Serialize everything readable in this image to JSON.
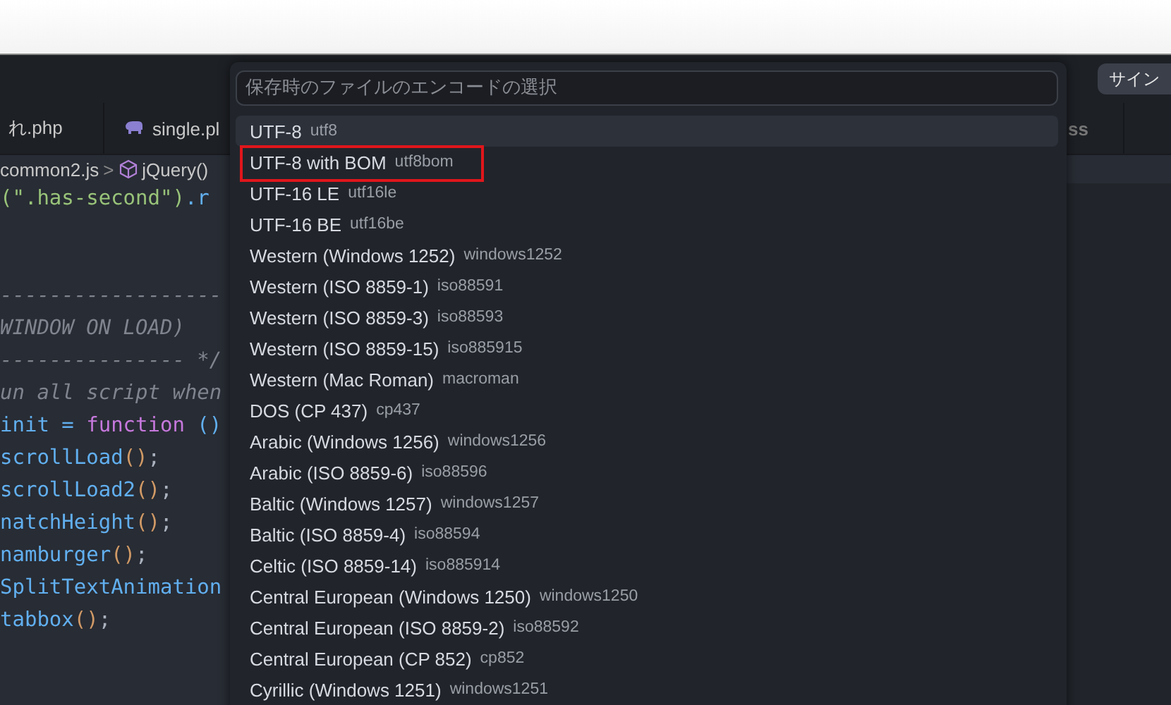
{
  "title_bar": {
    "button": "サイン"
  },
  "tabs": [
    {
      "label": "れ.php",
      "kind": "plain",
      "selected": false
    },
    {
      "label": "single.pl",
      "kind": "php",
      "selected": false
    },
    {
      "label": "ss",
      "kind": "plain",
      "selected": false
    }
  ],
  "breadcrumb": {
    "file": "common2.js",
    "separator": ">",
    "symbol": "jQuery()"
  },
  "code_lines": [
    [
      {
        "t": "(\".has-second\")",
        "kind": "str"
      },
      {
        "t": ".r",
        "kind": "fn"
      }
    ],
    [
      {
        "t": "------------------",
        "kind": "com"
      }
    ],
    [
      {
        "t": "WINDOW ON LOAD)",
        "kind": "com"
      }
    ],
    [
      {
        "t": "--------------- */",
        "kind": "com"
      }
    ],
    [
      {
        "t": "un all script when",
        "kind": "com"
      }
    ],
    [
      {
        "t": "init = ",
        "kind": "fn"
      },
      {
        "t": "function",
        "kind": "kw"
      },
      {
        "t": " ()",
        "kind": "fn"
      }
    ],
    [
      {
        "t": "scrollLoad",
        "kind": "fn"
      },
      {
        "t": "()",
        "kind": "par"
      },
      {
        "t": ";",
        "kind": "plain"
      }
    ],
    [
      {
        "t": "scrollLoad2",
        "kind": "fn"
      },
      {
        "t": "()",
        "kind": "par"
      },
      {
        "t": ";",
        "kind": "plain"
      }
    ],
    [
      {
        "t": "natchHeight",
        "kind": "fn"
      },
      {
        "t": "()",
        "kind": "par"
      },
      {
        "t": ";",
        "kind": "plain"
      }
    ],
    [
      {
        "t": "namburger",
        "kind": "fn"
      },
      {
        "t": "()",
        "kind": "par"
      },
      {
        "t": ";",
        "kind": "plain"
      }
    ],
    [
      {
        "t": "SplitTextAnimation",
        "kind": "fn"
      }
    ],
    [
      {
        "t": "tabbox",
        "kind": "fn"
      },
      {
        "t": "()",
        "kind": "par"
      },
      {
        "t": ";",
        "kind": "plain"
      }
    ]
  ],
  "palette": {
    "placeholder": "保存時のファイルのエンコードの選択",
    "items": [
      {
        "label": "UTF-8",
        "detail": "utf8",
        "selected": true,
        "highlighted": false
      },
      {
        "label": "UTF-8 with BOM",
        "detail": "utf8bom",
        "selected": false,
        "highlighted": true
      },
      {
        "label": "UTF-16 LE",
        "detail": "utf16le",
        "selected": false,
        "highlighted": false
      },
      {
        "label": "UTF-16 BE",
        "detail": "utf16be",
        "selected": false,
        "highlighted": false
      },
      {
        "label": "Western (Windows 1252)",
        "detail": "windows1252",
        "selected": false,
        "highlighted": false
      },
      {
        "label": "Western (ISO 8859-1)",
        "detail": "iso88591",
        "selected": false,
        "highlighted": false
      },
      {
        "label": "Western (ISO 8859-3)",
        "detail": "iso88593",
        "selected": false,
        "highlighted": false
      },
      {
        "label": "Western (ISO 8859-15)",
        "detail": "iso885915",
        "selected": false,
        "highlighted": false
      },
      {
        "label": "Western (Mac Roman)",
        "detail": "macroman",
        "selected": false,
        "highlighted": false
      },
      {
        "label": "DOS (CP 437)",
        "detail": "cp437",
        "selected": false,
        "highlighted": false
      },
      {
        "label": "Arabic (Windows 1256)",
        "detail": "windows1256",
        "selected": false,
        "highlighted": false
      },
      {
        "label": "Arabic (ISO 8859-6)",
        "detail": "iso88596",
        "selected": false,
        "highlighted": false
      },
      {
        "label": "Baltic (Windows 1257)",
        "detail": "windows1257",
        "selected": false,
        "highlighted": false
      },
      {
        "label": "Baltic (ISO 8859-4)",
        "detail": "iso88594",
        "selected": false,
        "highlighted": false
      },
      {
        "label": "Celtic (ISO 8859-14)",
        "detail": "iso885914",
        "selected": false,
        "highlighted": false
      },
      {
        "label": "Central European (Windows 1250)",
        "detail": "windows1250",
        "selected": false,
        "highlighted": false
      },
      {
        "label": "Central European (ISO 8859-2)",
        "detail": "iso88592",
        "selected": false,
        "highlighted": false
      },
      {
        "label": "Central European (CP 852)",
        "detail": "cp852",
        "selected": false,
        "highlighted": false
      },
      {
        "label": "Cyrillic (Windows 1251)",
        "detail": "windows1251",
        "selected": false,
        "highlighted": false
      }
    ]
  }
}
